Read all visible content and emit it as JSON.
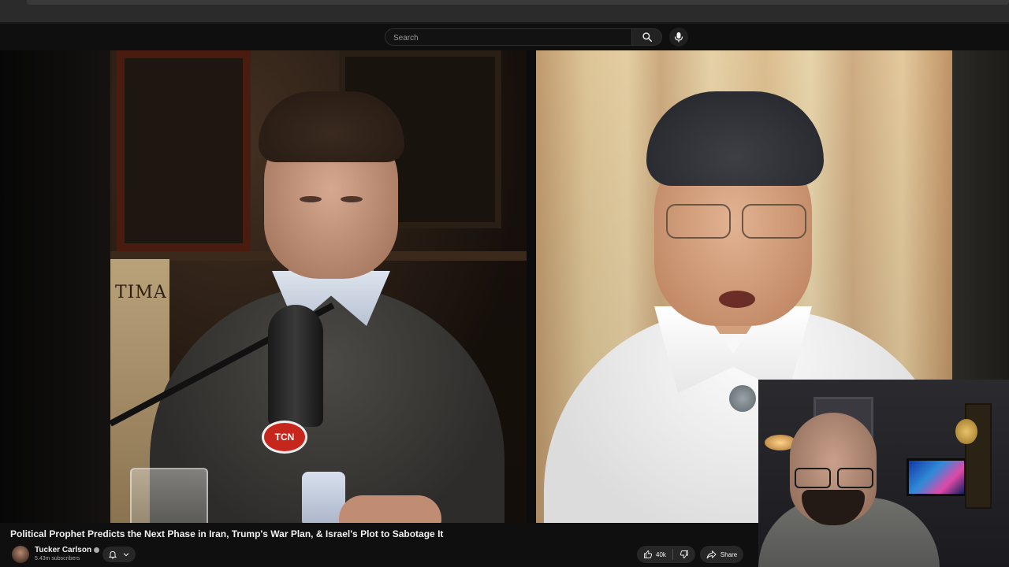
{
  "search": {
    "placeholder": "Search"
  },
  "icons": {
    "search": "search-icon",
    "mic": "microphone-icon",
    "bell": "bell-icon",
    "chevron": "chevron-down-icon",
    "like": "thumbs-up-icon",
    "dislike": "thumbs-down-icon",
    "share": "share-icon"
  },
  "video": {
    "host_mic_logo": "TCN",
    "host_poster_text": "TIMA"
  },
  "video_info": {
    "title": "Political Prophet Predicts the Next Phase in Iran, Trump's War Plan, & Israel's Plot to Sabotage It",
    "channel": {
      "name": "Tucker Carlson",
      "subscribers": "5.43m subscribers"
    },
    "actions": {
      "likes": "40k",
      "share_label": "Share"
    }
  },
  "colors": {
    "background": "#0f0f0f",
    "pill": "#272727",
    "text": "#f1f1f1",
    "muted": "#aaaaaa"
  }
}
